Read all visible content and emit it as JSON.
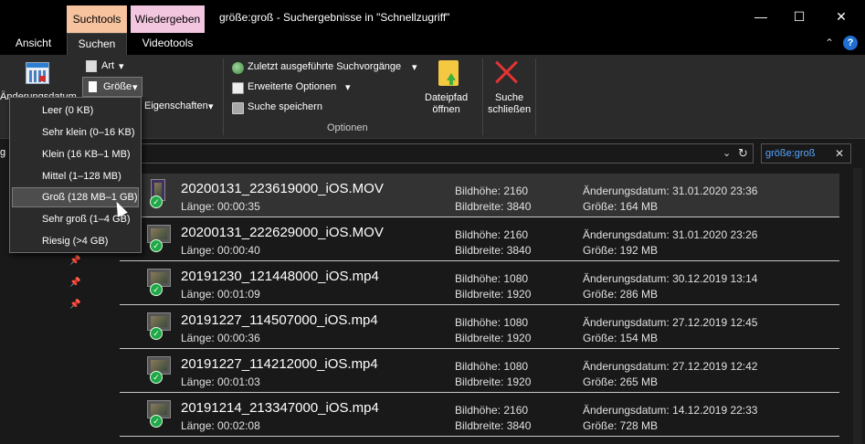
{
  "titlebar": {
    "context_tabs": [
      "Suchtools",
      "Wiedergeben"
    ],
    "title": "größe:groß - Suchergebnisse in \"Schnellzugriff\"",
    "minimize": "—",
    "maximize": "☐",
    "close": "✕"
  },
  "ribbon_tabs": [
    "Ansicht",
    "Suchen",
    "Videotools"
  ],
  "ribbon": {
    "aenderungsdatum": "Änderungsdatum",
    "art": "Art",
    "groesse": "Größe",
    "eigenschaften": "Eigenschaften",
    "caret": "▾",
    "recent_searches": "Zuletzt ausgeführte Suchvorgänge",
    "advanced_options": "Erweiterte Optionen",
    "save_search": "Suche speichern",
    "options_group": "Optionen",
    "open_path_1": "Dateipfad",
    "open_path_2": "öffnen",
    "close_search_1": "Suche",
    "close_search_2": "schließen"
  },
  "address": {
    "prefix": "g",
    "chevron": "⌄",
    "refresh": "↻"
  },
  "search": {
    "value": "größe:groß",
    "clear": "✕"
  },
  "size_menu": {
    "items": [
      "Leer (0 KB)",
      "Sehr klein (0–16 KB)",
      "Klein (16 KB–1 MB)",
      "Mittel (1–128 MB)",
      "Groß (128 MB–1 GB)",
      "Sehr groß (1–4 GB)",
      "Riesig (>4 GB)"
    ],
    "highlighted_index": 4
  },
  "files": [
    {
      "name": "20200131_223619000_iOS.MOV",
      "length": "Länge: 00:00:35",
      "height": "Bildhöhe: 2160",
      "width": "Bildbreite: 3840",
      "date": "Änderungsdatum: 31.01.2020 23:36",
      "size": "Größe: 164 MB"
    },
    {
      "name": "20200131_222629000_iOS.MOV",
      "length": "Länge: 00:00:40",
      "height": "Bildhöhe: 2160",
      "width": "Bildbreite: 3840",
      "date": "Änderungsdatum: 31.01.2020 23:26",
      "size": "Größe: 192 MB"
    },
    {
      "name": "20191230_121448000_iOS.mp4",
      "length": "Länge: 00:01:09",
      "height": "Bildhöhe: 1080",
      "width": "Bildbreite: 1920",
      "date": "Änderungsdatum: 30.12.2019 13:14",
      "size": "Größe: 286 MB"
    },
    {
      "name": "20191227_114507000_iOS.mp4",
      "length": "Länge: 00:00:36",
      "height": "Bildhöhe: 1080",
      "width": "Bildbreite: 1920",
      "date": "Änderungsdatum: 27.12.2019 12:45",
      "size": "Größe: 154 MB"
    },
    {
      "name": "20191227_114212000_iOS.mp4",
      "length": "Länge: 00:01:03",
      "height": "Bildhöhe: 1080",
      "width": "Bildbreite: 1920",
      "date": "Änderungsdatum: 27.12.2019 12:42",
      "size": "Größe: 265 MB"
    },
    {
      "name": "20191214_213347000_iOS.mp4",
      "length": "Länge: 00:02:08",
      "height": "Bildhöhe: 2160",
      "width": "Bildbreite: 3840",
      "date": "Änderungsdatum: 14.12.2019 22:33",
      "size": "Größe: 728 MB"
    }
  ],
  "colors": {
    "ctx_suchtools": "#f7c39f",
    "ctx_wiedergeben": "#f3c6e0",
    "search_text": "#58a6ff",
    "sync_check": "#1fa847"
  }
}
